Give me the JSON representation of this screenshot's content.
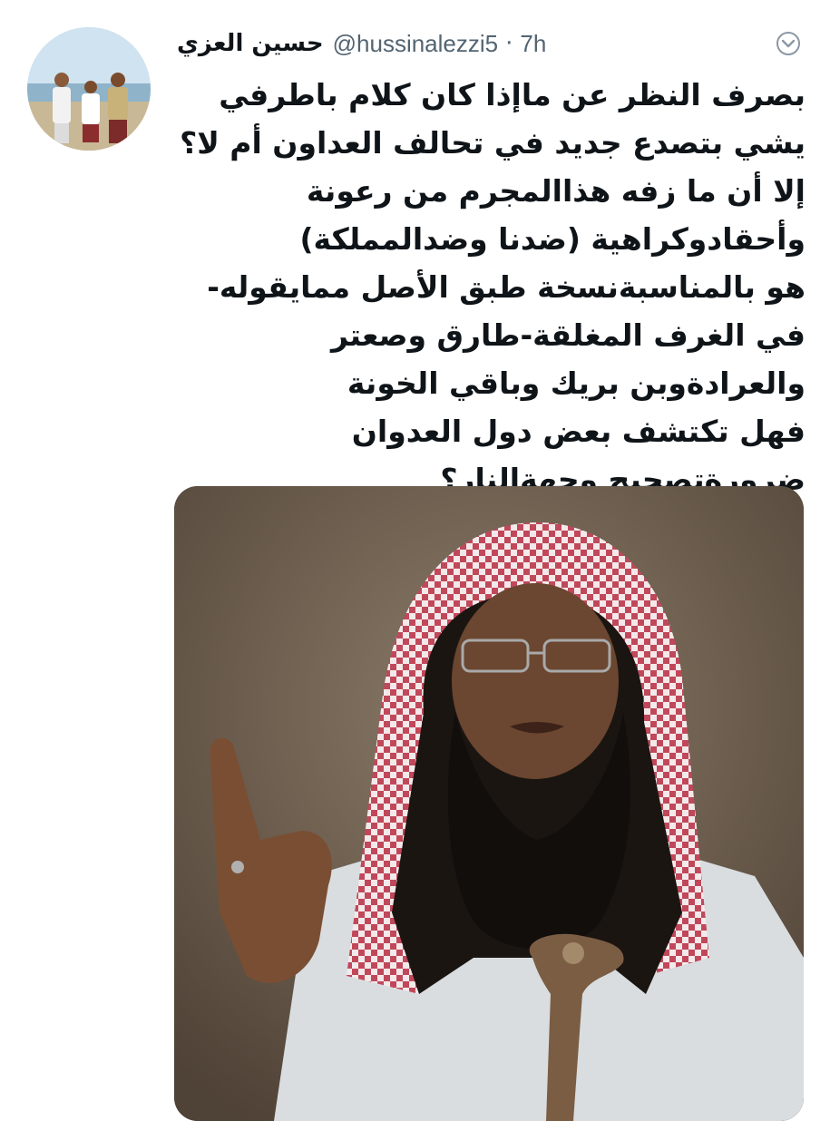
{
  "tweet": {
    "display_name": "حسين العزي",
    "handle": "@hussinalezzi5",
    "separator": "·",
    "time": "7h",
    "paragraphs": [
      "بصرف النظر عن ماإذا كان كلام باطرفي يشي بتصدع جديد في تحالف العداون أم لا؟إلا أن ما زفه هذاالمجرم من رعونة وأحقادوكراهية (ضدنا وضدالمملكة)",
      "هو بالمناسبةنسخة طبق الأصل ممايقوله-في الغرف المغلقة-طارق وصعتر والعرادةوبن بريك وباقي الخونة",
      "فهل تكتشف بعض دول العدوان ضرورةتصحيح وجهةالنار؟"
    ]
  },
  "icons": {
    "menu": "chevron-down-icon"
  },
  "colors": {
    "text_primary": "#0f1419",
    "text_secondary": "#536471",
    "background": "#ffffff"
  }
}
